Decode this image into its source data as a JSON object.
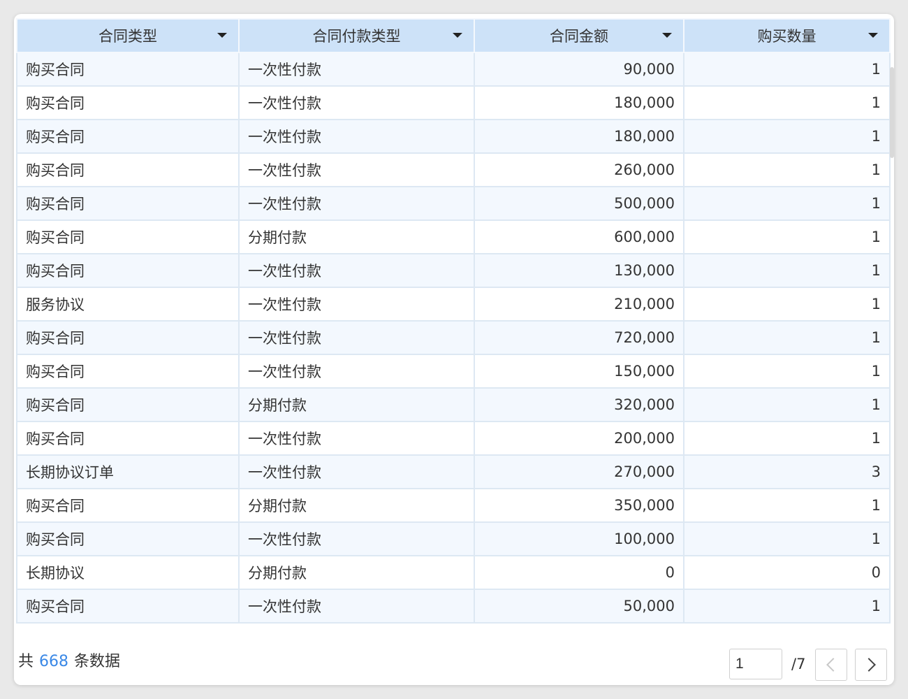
{
  "table": {
    "columns": [
      {
        "label": "合同类型"
      },
      {
        "label": "合同付款类型"
      },
      {
        "label": "合同金额"
      },
      {
        "label": "购买数量"
      }
    ],
    "rows": [
      [
        "购买合同",
        "一次性付款",
        "90,000",
        "1"
      ],
      [
        "购买合同",
        "一次性付款",
        "180,000",
        "1"
      ],
      [
        "购买合同",
        "一次性付款",
        "180,000",
        "1"
      ],
      [
        "购买合同",
        "一次性付款",
        "260,000",
        "1"
      ],
      [
        "购买合同",
        "一次性付款",
        "500,000",
        "1"
      ],
      [
        "购买合同",
        "分期付款",
        "600,000",
        "1"
      ],
      [
        "购买合同",
        "一次性付款",
        "130,000",
        "1"
      ],
      [
        "服务协议",
        "一次性付款",
        "210,000",
        "1"
      ],
      [
        "购买合同",
        "一次性付款",
        "720,000",
        "1"
      ],
      [
        "购买合同",
        "一次性付款",
        "150,000",
        "1"
      ],
      [
        "购买合同",
        "分期付款",
        "320,000",
        "1"
      ],
      [
        "购买合同",
        "一次性付款",
        "200,000",
        "1"
      ],
      [
        "长期协议订单",
        "一次性付款",
        "270,000",
        "3"
      ],
      [
        "购买合同",
        "分期付款",
        "350,000",
        "1"
      ],
      [
        "购买合同",
        "一次性付款",
        "100,000",
        "1"
      ],
      [
        "长期协议",
        "分期付款",
        "0",
        "0"
      ],
      [
        "购买合同",
        "一次性付款",
        "50,000",
        "1"
      ]
    ]
  },
  "footer": {
    "prefix": "共",
    "count": "668",
    "suffix": "条数据",
    "page_input_value": "1",
    "page_total": "/7"
  },
  "icons": {
    "sort": "caret-down-icon",
    "prev": "chevron-left-icon",
    "next": "chevron-right-icon"
  },
  "colors": {
    "header_bg": "#cde2f8",
    "row_alt_bg": "#f3f8fe",
    "accent": "#3a88e6"
  }
}
